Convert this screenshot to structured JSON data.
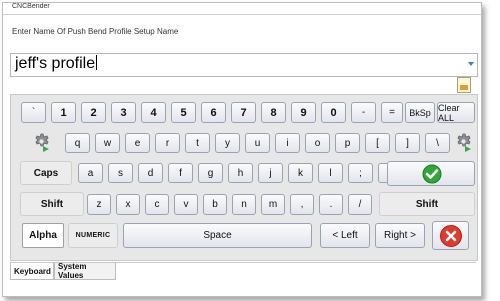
{
  "window": {
    "title": "CNCBender"
  },
  "prompt": "Enter Name Of Push Bend Profile Setup Name",
  "name_field": {
    "value": "jeff's profile"
  },
  "keyboard": {
    "row1": [
      "`",
      "1",
      "2",
      "3",
      "4",
      "5",
      "6",
      "7",
      "8",
      "9",
      "0",
      "-",
      "=",
      "BkSp",
      "Clear ALL"
    ],
    "row2": [
      "q",
      "w",
      "e",
      "r",
      "t",
      "y",
      "u",
      "i",
      "o",
      "p",
      "[",
      "]",
      "\\"
    ],
    "row3_caps": "Caps",
    "row3": [
      "a",
      "s",
      "d",
      "f",
      "g",
      "h",
      "j",
      "k",
      "l",
      ";",
      "'"
    ],
    "row4_left": "Shift",
    "row4": [
      "z",
      "x",
      "c",
      "v",
      "b",
      "n",
      "m",
      ",",
      ".",
      "/"
    ],
    "row4_right": "Shift",
    "alpha": "Alpha",
    "numeric": "NUMERIC",
    "space": "Space",
    "left": "< Left",
    "right": "Right >"
  },
  "tabs": [
    "Keyboard",
    "System Values"
  ],
  "colors": {
    "ok_green": "#2fa83a",
    "cancel_red": "#e03a2a",
    "key_border": "#9aa3b3"
  }
}
